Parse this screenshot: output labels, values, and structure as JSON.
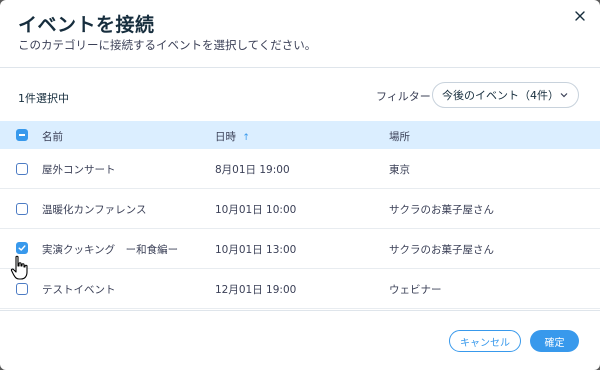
{
  "dialog": {
    "title": "イベントを接続",
    "subtitle": "このカテゴリーに接続するイベントを選択してください。"
  },
  "toolbar": {
    "selected_count": "1件選択中",
    "filter_label": "フィルター",
    "filter_value": "今後のイベント（4件）"
  },
  "table": {
    "headers": {
      "name": "名前",
      "datetime": "日時",
      "sort_arrow": "↑",
      "place": "場所"
    },
    "select_all_state": "indeterminate",
    "rows": [
      {
        "name": "屋外コンサート",
        "datetime": "8月01日 19:00",
        "place": "東京",
        "checked": false
      },
      {
        "name": "温暖化カンファレンス",
        "datetime": "10月01日 10:00",
        "place": "サクラのお菓子屋さん",
        "checked": false
      },
      {
        "name": "実演クッキング　ー和食編ー",
        "datetime": "10月01日 13:00",
        "place": "サクラのお菓子屋さん",
        "checked": true
      },
      {
        "name": "テストイベント",
        "datetime": "12月01日 19:00",
        "place": "ウェビナー",
        "checked": false
      }
    ]
  },
  "footer": {
    "cancel_label": "キャンセル",
    "ok_label": "確定"
  },
  "colors": {
    "accent": "#3899ec",
    "header_bg": "#dbeeff",
    "title": "#162d3d"
  }
}
